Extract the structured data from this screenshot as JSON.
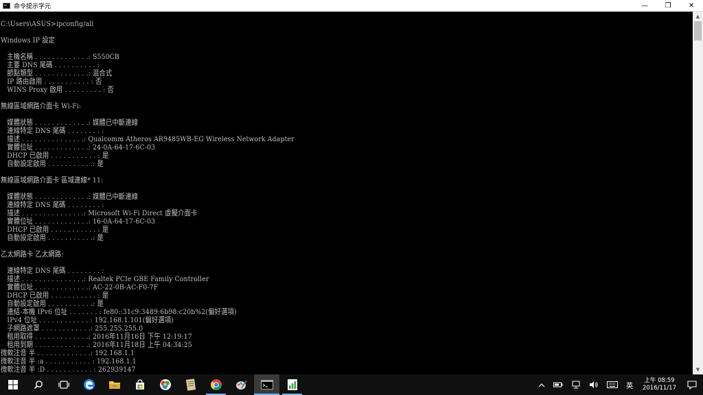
{
  "window": {
    "title": "命令提示字元",
    "minimize": "—",
    "maximize": "❐",
    "close": "✕"
  },
  "console": {
    "lines": [
      "C:\\Users\\ASUS>ipconfig/all",
      "",
      "Windows IP 設定",
      "",
      "   主機名稱 . . . . . . . . . . . . .: S550CB",
      "   主要 DNS 尾碼 . . . . . . . . . . :",
      "   節點類型 . . . . . . . . . . . . .: 混合式",
      "   IP 路由啟用 . . . . . . . . . . . : 否",
      "   WINS Proxy 啟用 . . . . . . . . . : 否",
      "",
      "無線區域網路介面卡 Wi-Fi:",
      "",
      "   媒體狀態 . . . . . . . . . . . . .: 媒體已中斷連線",
      "   連線特定 DNS 尾碼 . . . . . . . . :",
      "   描述 . . . . . . . . . . . . . . .: Qualcomm Atheros AR9485WB-EG Wireless Network Adapter",
      "   實體位址 . . . . . . . . . . . . .: 24-0A-64-17-6C-03",
      "   DHCP 已啟用 . . . . . . . . . . . : 是",
      "   自動設定啟用 . . . . . . . . . . .: 是",
      "",
      "無線區域網路介面卡 區域連線* 11:",
      "",
      "   媒體狀態 . . . . . . . . . . . . .: 媒體已中斷連線",
      "   連線特定 DNS 尾碼 . . . . . . . . :",
      "   描述 . . . . . . . . . . . . . . .: Microsoft Wi-Fi Direct 虛擬介面卡",
      "   實體位址 . . . . . . . . . . . . .: 16-0A-64-17-6C-03",
      "   DHCP 已啟用 . . . . . . . . . . . : 是",
      "   自動設定啟用 . . . . . . . . . . .: 是",
      "",
      "乙太網路卡 乙太網路:",
      "",
      "   連線特定 DNS 尾碼 . . . . . . . . :",
      "   描述 . . . . . . . . . . . . . . .: Realtek PCIe GBE Family Controller",
      "   實體位址 . . . . . . . . . . . . .: AC-22-0B-AC-F0-7F",
      "   DHCP 已啟用 . . . . . . . . . . . : 是",
      "   自動設定啟用 . . . . . . . . . . .: 是",
      "   連結-本機 IPv6 位址 . . . . . . . : fe80::31c9:3489:6b98:c20b%2(偏好選項)",
      "   IPv4 位址 . . . . . . . . . . . . : 192.168.1.101(偏好選項)",
      "   子網路遮罩 . . . . . . . . . . . .: 255.255.255.0",
      "   租用取得 . . . . . . . . . . . . .: 2016年11月16日 下午 12:19:17",
      "   租用到期 . . . . . . . . . . . . .: 2016年11月18日 上午 04:34:25",
      "微軟注音 半 . . . . . . . . . . . . .: 192.168.1.1",
      "微軟注音 半 :a . . . . . . . . . . . : 192.168.1.1",
      "微軟注音 半 :D . . . . . . . . . . . : 262939147"
    ]
  },
  "taskbar": {
    "items": [
      {
        "name": "start-button",
        "icon": "windows-logo-icon"
      },
      {
        "name": "search-button",
        "icon": "search-icon"
      },
      {
        "name": "task-view-button",
        "icon": "task-view-icon"
      },
      {
        "name": "edge-button",
        "icon": "edge-icon"
      },
      {
        "name": "file-explorer-button",
        "icon": "folder-icon"
      },
      {
        "name": "store-button",
        "icon": "store-icon"
      },
      {
        "name": "app-button-1",
        "icon": "app-icon"
      },
      {
        "name": "app-button-2",
        "icon": "app-icon"
      },
      {
        "name": "chrome-button",
        "icon": "chrome-icon"
      },
      {
        "name": "app-button-3",
        "icon": "app-icon"
      },
      {
        "name": "cmd-button",
        "icon": "cmd-icon"
      },
      {
        "name": "app-button-4",
        "icon": "app-icon"
      }
    ],
    "tray": {
      "ime_mode": "英",
      "time": "上午 08:59",
      "date": "2016/11/17"
    }
  },
  "colors": {
    "console_bg": "#000000",
    "console_text": "#c0c0c0",
    "taskbar_bg": "#101010",
    "accent": "#76b9ed"
  }
}
